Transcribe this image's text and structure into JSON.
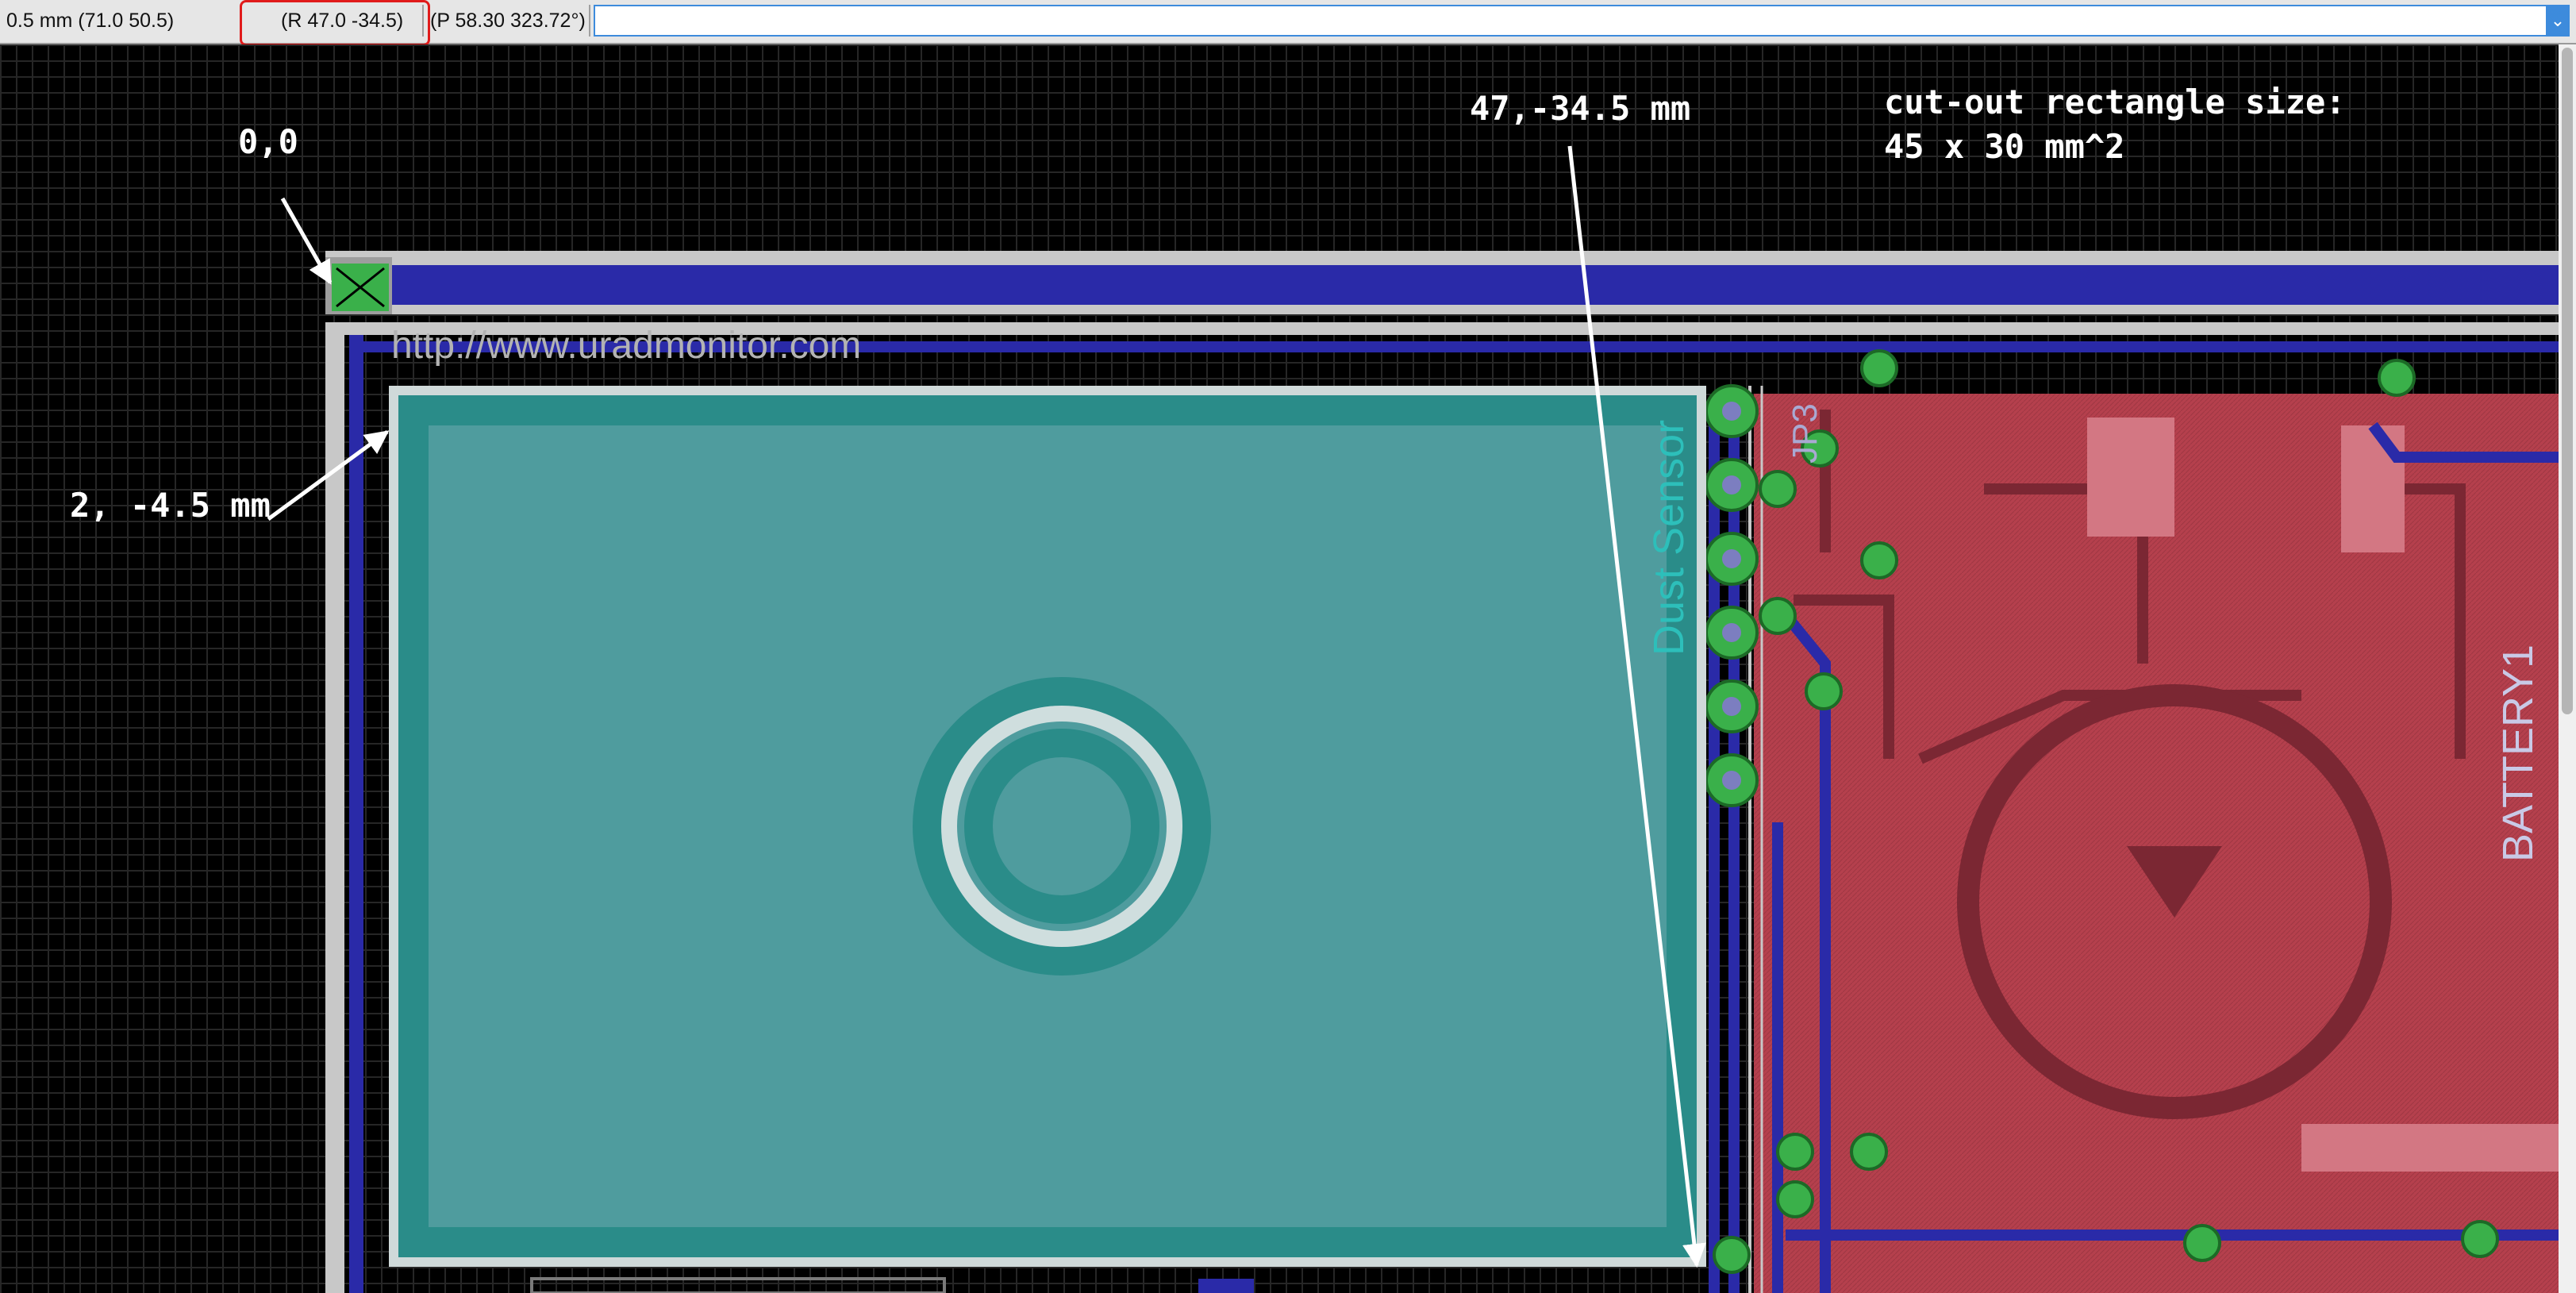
{
  "status_bar": {
    "grid_info": "0.5 mm (71.0 50.5)",
    "relative_coords": "(R 47.0 -34.5)",
    "polar_coords": "(P 58.30 323.72°)",
    "command_value": ""
  },
  "annotations": {
    "origin_label": "0,0",
    "top_left_label": "2, -4.5 mm",
    "bottom_right_label": "47,-34.5 mm",
    "cutout_line1": "cut-out rectangle size:",
    "cutout_line2": "45 x 30 mm^2"
  },
  "board_labels": {
    "url": "http://www.uradmonitor.com",
    "dust_sensor": "Dust Sensor",
    "jp3": "JP3",
    "battery": "BATTERY1"
  },
  "colors": {
    "grid": "#262626",
    "board_outline": "#c8c8c8",
    "bottom_layer": "#2a2aa8",
    "top_layer": "#b5404d",
    "cutout_fill": "#4f9c9e",
    "cutout_border": "#2a8c89",
    "via_green": "#3ab04a",
    "highlight_box": "#e01b1b"
  }
}
